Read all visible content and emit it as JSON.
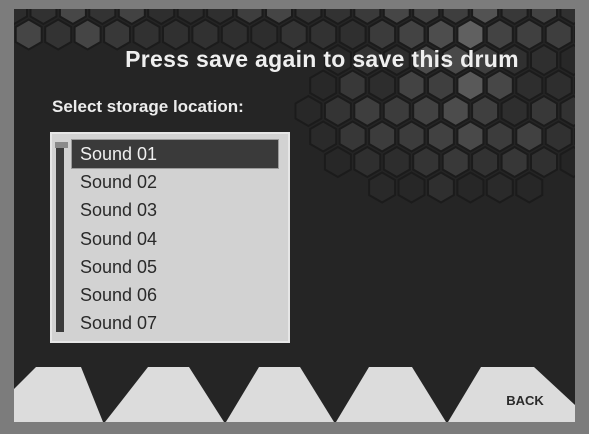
{
  "header": {
    "title": "Press save again to save this drum"
  },
  "storage": {
    "prompt": "Select storage location:",
    "items": [
      "Sound 01",
      "Sound 02",
      "Sound 03",
      "Sound 04",
      "Sound 05",
      "Sound 06",
      "Sound 07"
    ],
    "selected_item": "Sound 01"
  },
  "softkeys": {
    "labels": [
      "",
      "",
      "",
      "",
      "BACK"
    ]
  },
  "colors": {
    "background": "#252525",
    "frame": "#7c7c7c",
    "list_background": "#d2d2d2",
    "selection": "#3a3a3a",
    "softkey": "#dcdcdc"
  }
}
